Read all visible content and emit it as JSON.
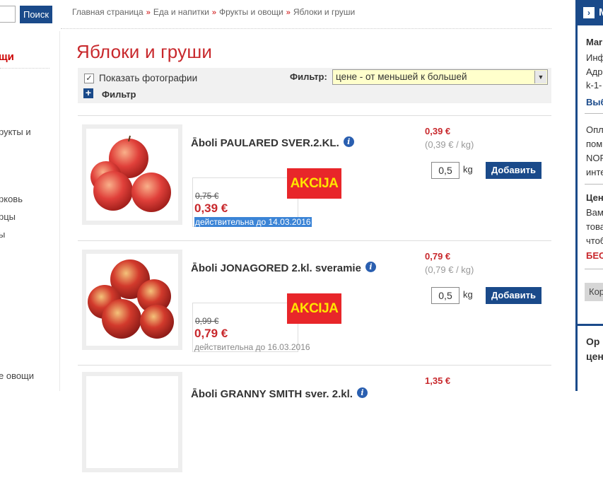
{
  "search": {
    "button_label": "Поиск",
    "placeholder": ""
  },
  "breadcrumb": {
    "items": [
      "Главная страница",
      "Еда и напитки",
      "Фрукты и овощи",
      "Яблоки и груши"
    ],
    "separator": "»"
  },
  "sidebar": {
    "active_category": "щи",
    "items": [
      "рукты и",
      "рковь",
      "рцы",
      "ы",
      "е овощи"
    ]
  },
  "page": {
    "title": "Яблоки и груши"
  },
  "toolbar": {
    "show_photos_label": "Показать фотографии",
    "show_photos_checked": true,
    "filter_toggle_label": "Фильтр",
    "sort_label": "Фильтр:",
    "sort_value": "цене - от меньшей к большей"
  },
  "products": [
    {
      "name": "Āboli PAULARED SVER.2.KL.",
      "badge": "AKCIJA",
      "old_price": "0,75 €",
      "promo_price": "0,39 €",
      "valid_until": "действительна до 14.03.2016",
      "unit_price": "0,39 €",
      "unit_price_per_kg": "(0,39 € / kg)",
      "quantity": "0,5",
      "unit": "kg",
      "add_label": "Добавить",
      "image": "red-apples-image"
    },
    {
      "name": "Āboli JONAGORED 2.kl. sveramie",
      "badge": "AKCIJA",
      "old_price": "0,99 €",
      "promo_price": "0,79 €",
      "valid_until": "действительна до 16.03.2016",
      "unit_price": "0,79 €",
      "unit_price_per_kg": "(0,79 € / kg)",
      "quantity": "0,5",
      "unit": "kg",
      "add_label": "Добавить",
      "image": "red-apples-image"
    },
    {
      "name": "Āboli GRANNY SMITH sver. 2.kl.",
      "unit_price": "1,35 €",
      "image": "apples-image"
    }
  ],
  "right_panel": {
    "header": "M",
    "lines": [
      "Mar",
      "Инф",
      "Адр",
      "k-1-",
      "Выб",
      "Опл",
      "пом",
      "NOR",
      "инте",
      "Цен",
      "Вам",
      "това",
      "чтоб",
      "БЕС",
      "Кор",
      "Op",
      "цен"
    ]
  },
  "colors": {
    "brand_blue": "#1a4a8a",
    "accent_red": "#c8282c",
    "akcija_bg": "#e8262a",
    "akcija_text": "#ffe500"
  }
}
